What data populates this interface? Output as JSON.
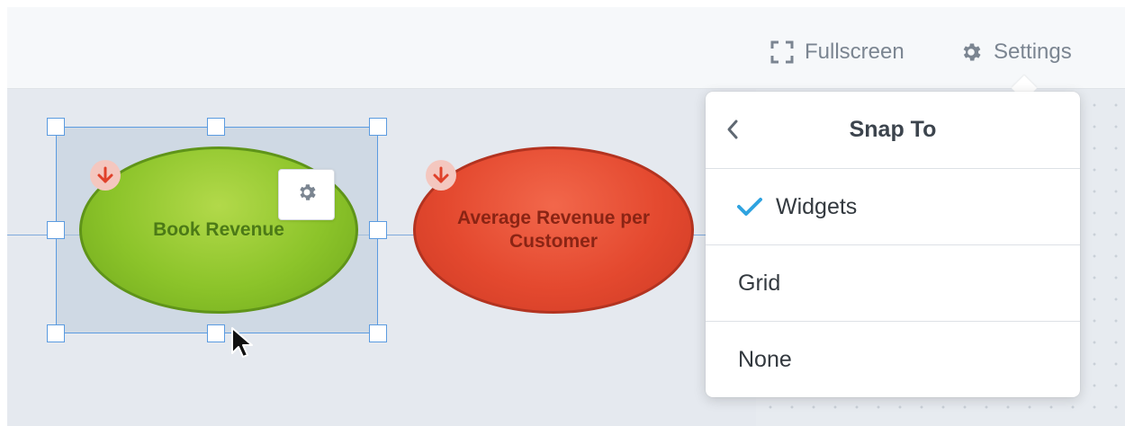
{
  "toolbar": {
    "fullscreen_label": "Fullscreen",
    "fullscreen_icon": "fullscreen-icon",
    "settings_label": "Settings",
    "settings_icon": "gear-icon"
  },
  "widgets": [
    {
      "label": "Book Revenue",
      "color": "#8cc42a",
      "trend_icon": "arrow-down-icon",
      "selected": true,
      "settings_icon": "gear-icon"
    },
    {
      "label": "Average Revenue per Customer",
      "color": "#e4492f",
      "trend_icon": "arrow-down-icon",
      "selected": false
    }
  ],
  "snap_menu": {
    "title": "Snap To",
    "back_icon": "chevron-left-icon",
    "options": [
      {
        "label": "Widgets",
        "checked": true
      },
      {
        "label": "Grid",
        "checked": false
      },
      {
        "label": "None",
        "checked": false
      }
    ],
    "check_icon": "checkmark-icon",
    "accent_color": "#2fa3e0"
  },
  "colors": {
    "selection": "#5b9be0",
    "trend_arrow": "#e0412a",
    "canvas": "#e5e9ef"
  }
}
